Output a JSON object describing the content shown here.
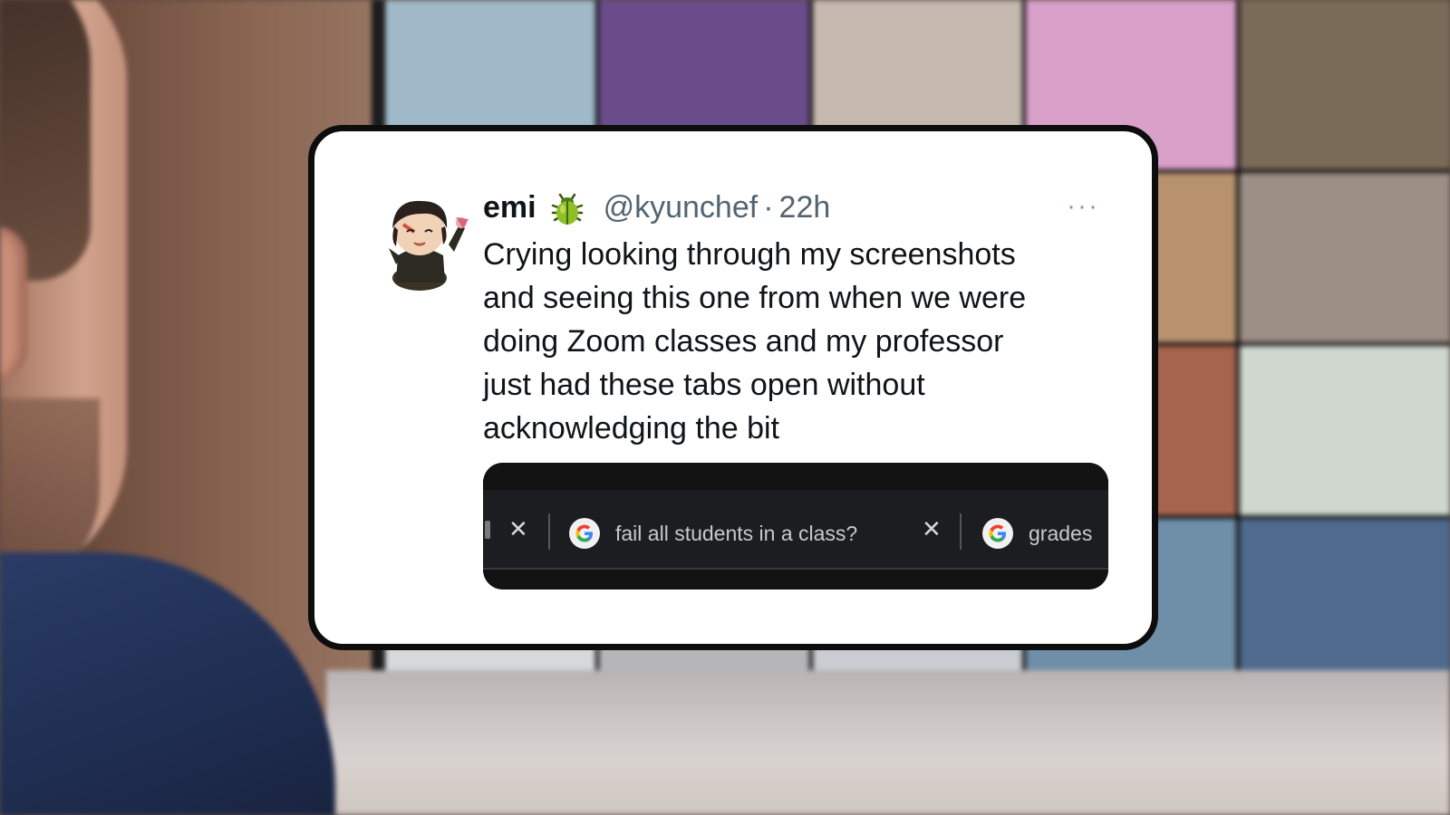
{
  "tweet": {
    "display_name": "emi",
    "handle": "@kyunchef",
    "time_sep": "·",
    "time": "22h",
    "more": "···",
    "badge_icon": "beetle-icon",
    "text_lines": [
      "Crying looking through my screenshots",
      "and seeing this one from when we were",
      "doing Zoom classes and my professor",
      "just had these tabs open without",
      "acknowledging the bit"
    ]
  },
  "screenshot": {
    "tabs": [
      {
        "label": "",
        "icon": "google-icon",
        "close": "✕"
      },
      {
        "label": "fail all students in a class?",
        "icon": "google-icon",
        "close": "✕"
      },
      {
        "label": "grades",
        "icon": "google-icon"
      }
    ]
  },
  "colors": {
    "card_bg": "#ffffff",
    "card_border": "#0d0d0d",
    "handle": "#536471",
    "browser_bar": "#1c1d20"
  }
}
